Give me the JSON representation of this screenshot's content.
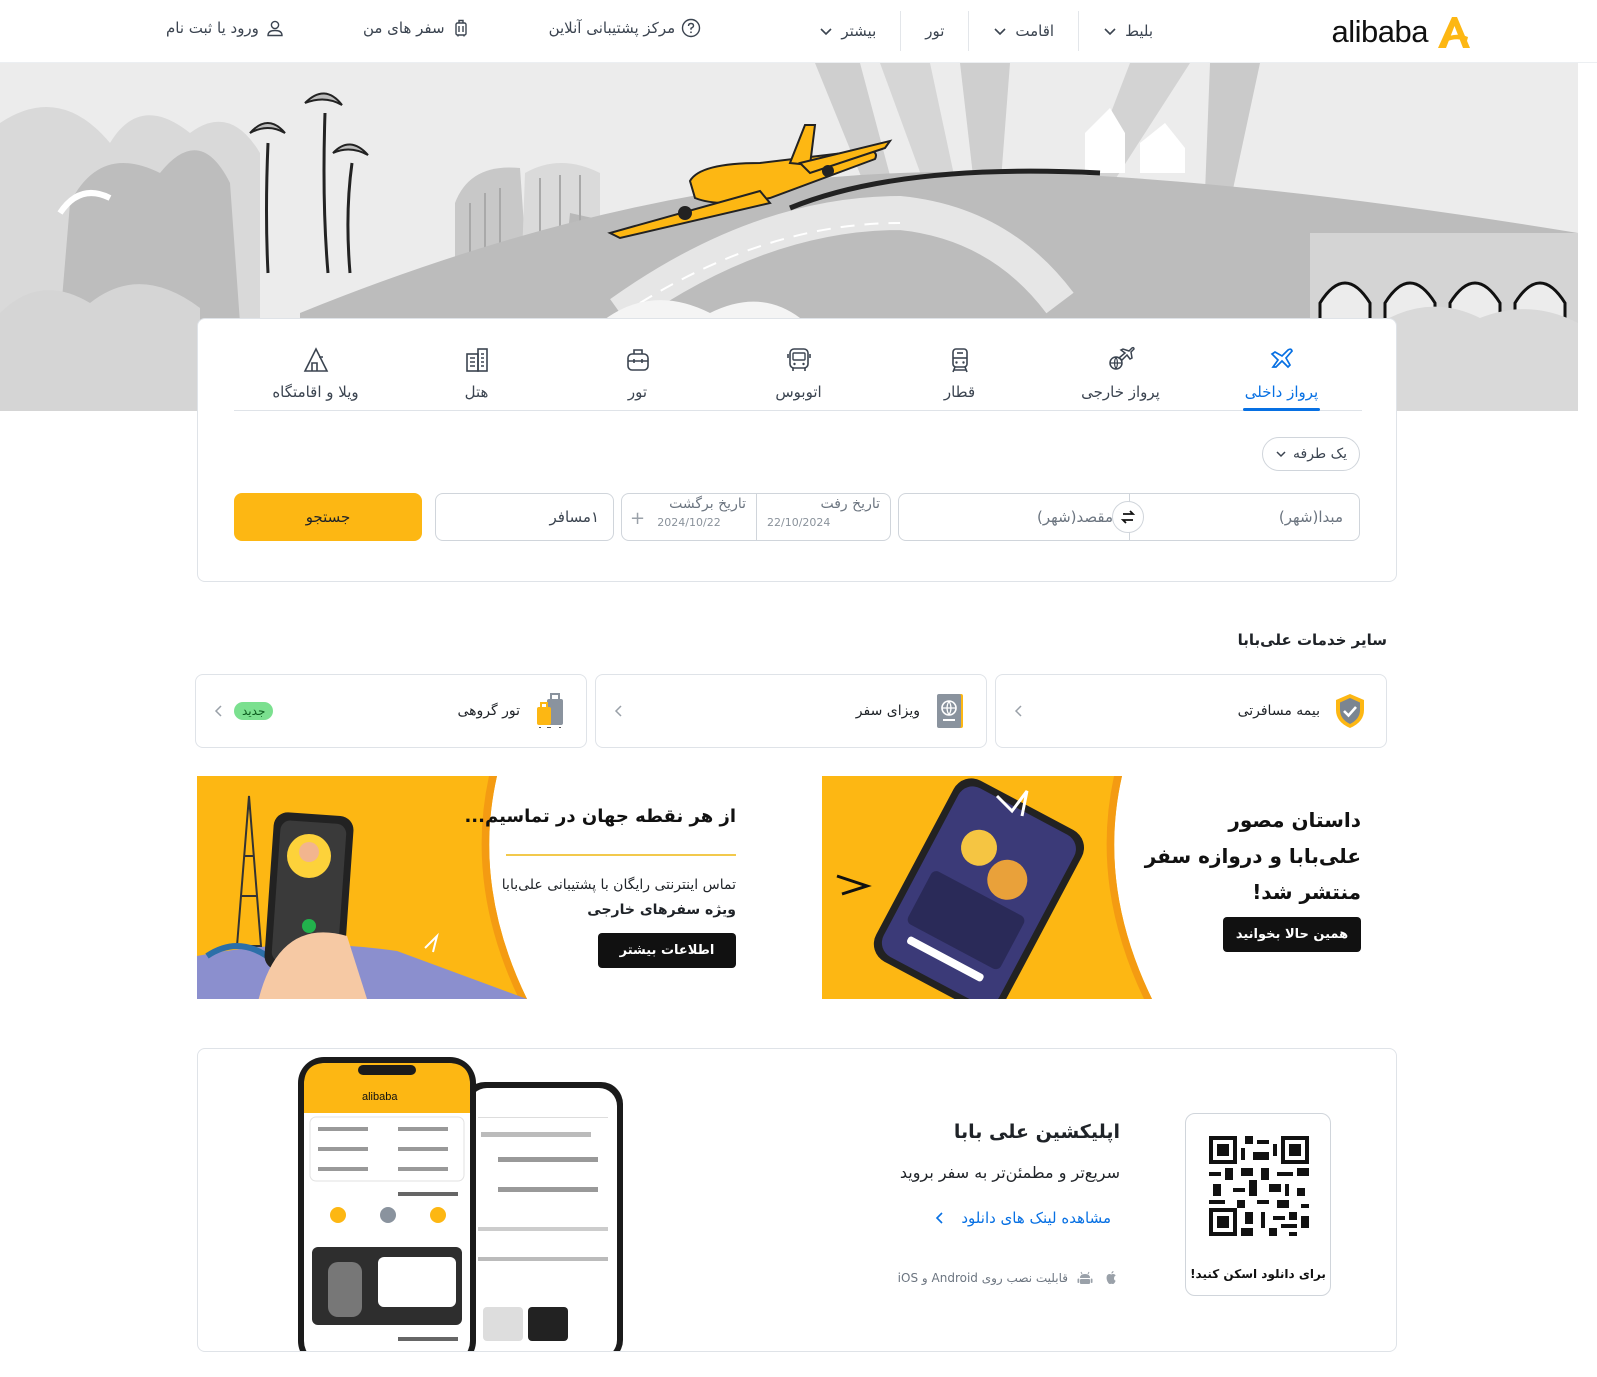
{
  "header": {
    "logo_text": "alibaba",
    "nav": [
      {
        "label": "بلیط",
        "has_dropdown": true
      },
      {
        "label": "اقامت",
        "has_dropdown": true
      },
      {
        "label": "تور",
        "has_dropdown": false
      },
      {
        "label": "بیشتر",
        "has_dropdown": true
      }
    ],
    "support": "مرکز پشتیبانی آنلاین",
    "my_trips": "سفر های من",
    "login": "ورود یا ثبت نام"
  },
  "search": {
    "tabs": [
      {
        "label": "پرواز داخلی",
        "icon": "domestic-flight-icon",
        "active": true
      },
      {
        "label": "پرواز خارجی",
        "icon": "international-flight-icon",
        "active": false
      },
      {
        "label": "قطار",
        "icon": "train-icon",
        "active": false
      },
      {
        "label": "اتوبوس",
        "icon": "bus-icon",
        "active": false
      },
      {
        "label": "تور",
        "icon": "tour-icon",
        "active": false
      },
      {
        "label": "هتل",
        "icon": "hotel-icon",
        "active": false
      },
      {
        "label": "ویلا و اقامتگاه",
        "icon": "villa-icon",
        "active": false
      }
    ],
    "trip_type": "یک طرفه",
    "origin_placeholder": "مبدا(شهر)",
    "destination_placeholder": "مقصد(شهر)",
    "depart_label": "تاریخ رفت",
    "depart_value": "22/10/2024",
    "return_label": "تاریخ برگشت",
    "return_value": "2024/10/22",
    "passengers": "۱مسافر",
    "button": "جستجو"
  },
  "services": {
    "title": "سایر خدمات علی‌بابا",
    "items": [
      {
        "label": "بیمه مسافرتی",
        "icon": "insurance-shield-icon"
      },
      {
        "label": "ویزای سفر",
        "icon": "passport-icon"
      },
      {
        "label": "تور گروهی",
        "icon": "luggage-icon",
        "badge": "جدید"
      }
    ]
  },
  "banners": {
    "story": {
      "title_lines": [
        "داستان مصور",
        "علی‌بابا و دروازه سفر",
        "منتشر شد!"
      ],
      "button": "همین حالا بخوانید",
      "accent": "#fdb713"
    },
    "support": {
      "title": "از هر نقطه جهان در تماسیم...",
      "desc_line1": "تماس اینترنتی رایگان با پشتیبانی علی‌بابا",
      "desc_line2": "ویژه سفرهای خارجی",
      "button": "اطلاعات بیشتر"
    }
  },
  "app": {
    "qr_caption": "برای دانلود اسکن کنید!",
    "title": "اپلیکشین علی بابا",
    "subtitle": "سریع‌تر و مطمئن‌تر به سفر بروید",
    "link": "مشاهده لینک های دانلود",
    "platforms": "قابلیت نصب روی Android و iOS",
    "phone_logo": "alibaba"
  },
  "colors": {
    "brand_yellow": "#fdb713",
    "active_blue": "#0770e3",
    "new_badge": "#7be08f"
  }
}
